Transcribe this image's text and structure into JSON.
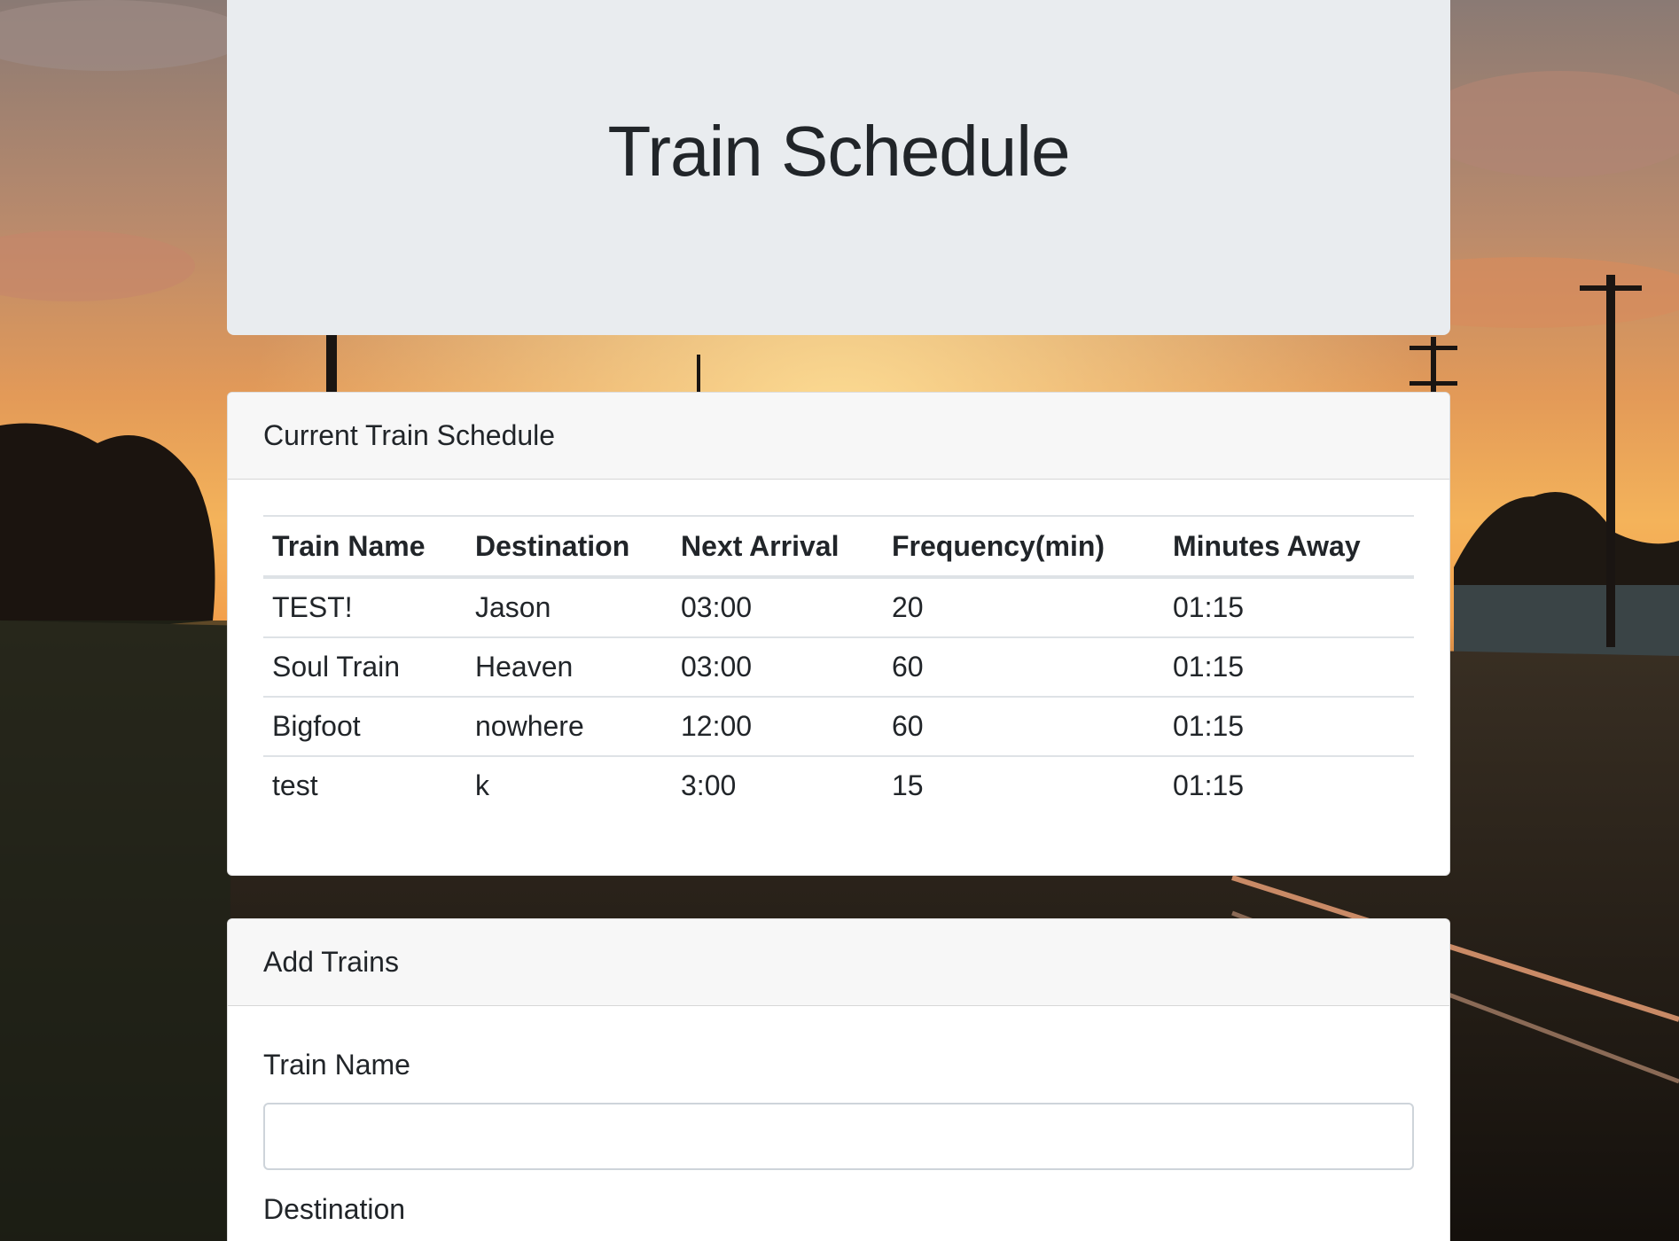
{
  "jumbotron": {
    "title": "Train Schedule"
  },
  "schedule": {
    "header": "Current Train Schedule",
    "columns": [
      "Train Name",
      "Destination",
      "Next Arrival",
      "Frequency(min)",
      "Minutes Away"
    ],
    "rows": [
      [
        "TEST!",
        "Jason",
        "03:00",
        "20",
        "01:15"
      ],
      [
        "Soul Train",
        "Heaven",
        "03:00",
        "60",
        "01:15"
      ],
      [
        "Bigfoot",
        "nowhere",
        "12:00",
        "60",
        "01:15"
      ],
      [
        "test",
        "k",
        "3:00",
        "15",
        "01:15"
      ]
    ]
  },
  "add_trains": {
    "header": "Add Trains",
    "train_name_label": "Train Name",
    "train_name_value": "",
    "destination_label": "Destination"
  },
  "colors": {
    "jumbotron_bg": "#e9ecef",
    "card_header_bg": "#f7f7f7",
    "text": "#212529"
  }
}
